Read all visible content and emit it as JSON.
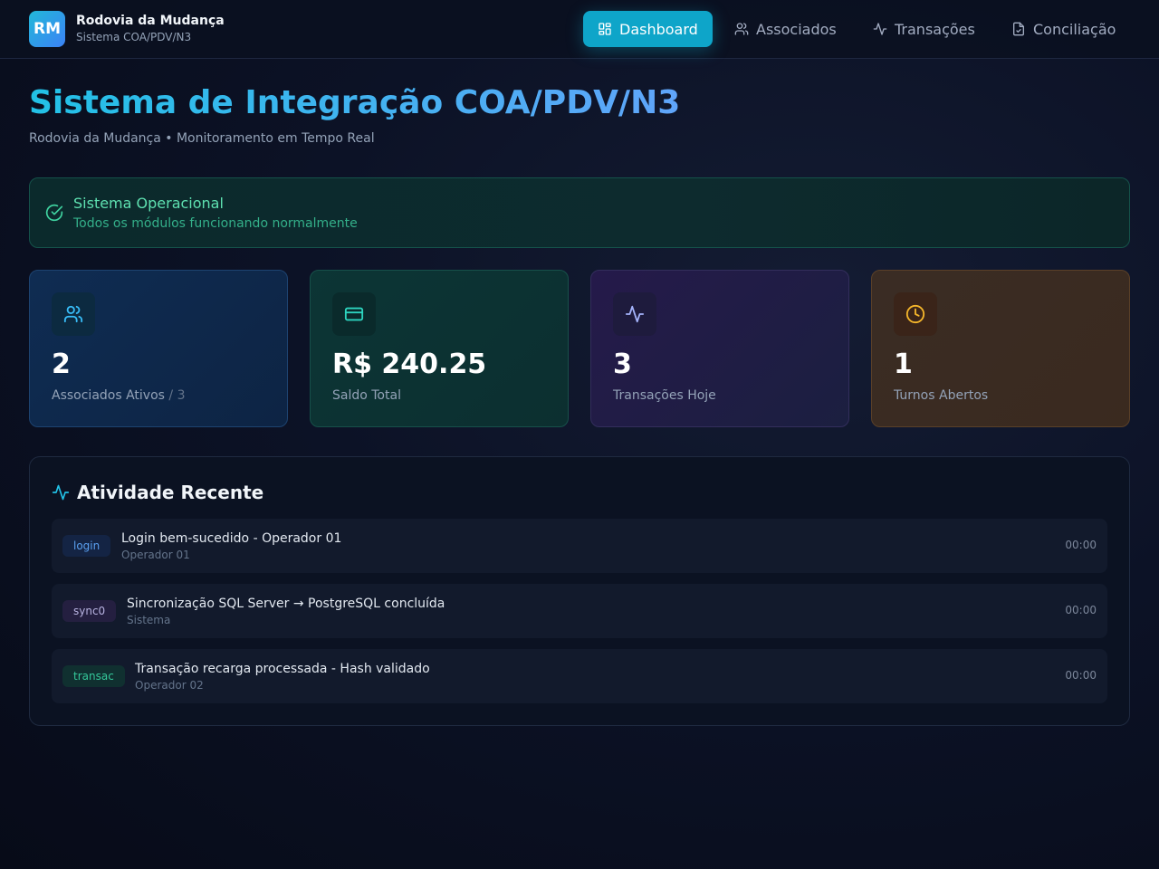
{
  "header": {
    "logo_text": "RM",
    "brand_name": "Rodovia da Mudança",
    "brand_sub": "Sistema COA/PDV/N3",
    "nav": [
      {
        "label": "Dashboard",
        "icon": "dashboard-icon",
        "active": true
      },
      {
        "label": "Associados",
        "icon": "users-icon",
        "active": false
      },
      {
        "label": "Transações",
        "icon": "activity-icon",
        "active": false
      },
      {
        "label": "Conciliação",
        "icon": "file-check-icon",
        "active": false
      }
    ]
  },
  "page": {
    "title": "Sistema de Integração COA/PDV/N3",
    "subtitle": "Rodovia da Mudança • Monitoramento em Tempo Real"
  },
  "status": {
    "title": "Sistema Operacional",
    "description": "Todos os módulos funcionando normalmente",
    "icon": "check-circle-icon"
  },
  "stats": [
    {
      "value": "2",
      "label": "Associados Ativos",
      "sub": " / 3",
      "icon": "users-icon"
    },
    {
      "value": "R$ 240.25",
      "label": "Saldo Total",
      "icon": "credit-card-icon"
    },
    {
      "value": "3",
      "label": "Transações Hoje",
      "icon": "activity-icon"
    },
    {
      "value": "1",
      "label": "Turnos Abertos",
      "icon": "clock-icon"
    }
  ],
  "activity": {
    "title": "Atividade Recente",
    "items": [
      {
        "badge": "login",
        "message": "Login bem-sucedido - Operador 01",
        "actor": "Operador 01",
        "time": "00:00"
      },
      {
        "badge": "sync0",
        "message": "Sincronização SQL Server → PostgreSQL concluída",
        "actor": "Sistema",
        "time": "00:00"
      },
      {
        "badge": "transac",
        "message": "Transação recarga processada - Hash validado",
        "actor": "Operador 02",
        "time": "00:00"
      }
    ]
  },
  "colors": {
    "accent": "#0ea5c9",
    "success": "#5ee0b0",
    "warning": "#f5b62b"
  }
}
